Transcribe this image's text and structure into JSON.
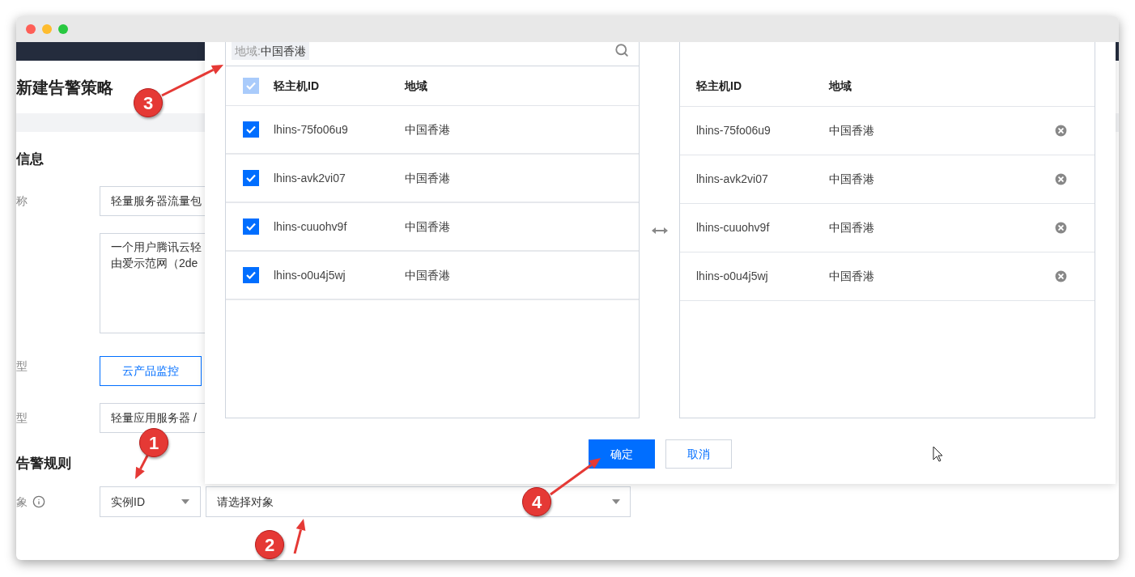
{
  "page": {
    "title": "新建告警策略",
    "basic_info": {
      "heading": "信息",
      "name_label": "称",
      "name_value": "轻量服务器流量包",
      "description_lines": [
        "一个用户腾讯云轻",
        "由爱示范网（2de"
      ],
      "policy_type_label": "型",
      "policy_type_button": "云产品监控",
      "product_label": "型",
      "product_value": "轻量应用服务器 /"
    },
    "alarm_rules": {
      "heading": "告警规则",
      "object_label": "象",
      "object_type": "实例ID",
      "object_placeholder": "请选择对象"
    }
  },
  "dialog": {
    "search_tag": {
      "label": "地域:",
      "value": "中国香港"
    },
    "left_table": {
      "select_all_checked": true,
      "columns": [
        "轻主机ID",
        "地域"
      ],
      "rows": [
        {
          "id": "lhins-75fo06u9",
          "region": "中国香港",
          "checked": true
        },
        {
          "id": "lhins-avk2vi07",
          "region": "中国香港",
          "checked": true
        },
        {
          "id": "lhins-cuuohv9f",
          "region": "中国香港",
          "checked": true
        },
        {
          "id": "lhins-o0u4j5wj",
          "region": "中国香港",
          "checked": true
        }
      ]
    },
    "right_table": {
      "columns": [
        "轻主机ID",
        "地域"
      ],
      "rows": [
        {
          "id": "lhins-75fo06u9",
          "region": "中国香港"
        },
        {
          "id": "lhins-avk2vi07",
          "region": "中国香港"
        },
        {
          "id": "lhins-cuuohv9f",
          "region": "中国香港"
        },
        {
          "id": "lhins-o0u4j5wj",
          "region": "中国香港"
        }
      ]
    },
    "buttons": [
      {
        "label": "确定",
        "kind": "primary"
      },
      {
        "label": "取消",
        "kind": "secondary"
      }
    ]
  },
  "annotations": [
    {
      "number": "3"
    },
    {
      "number": "1"
    },
    {
      "number": "4"
    },
    {
      "number": "2"
    }
  ]
}
